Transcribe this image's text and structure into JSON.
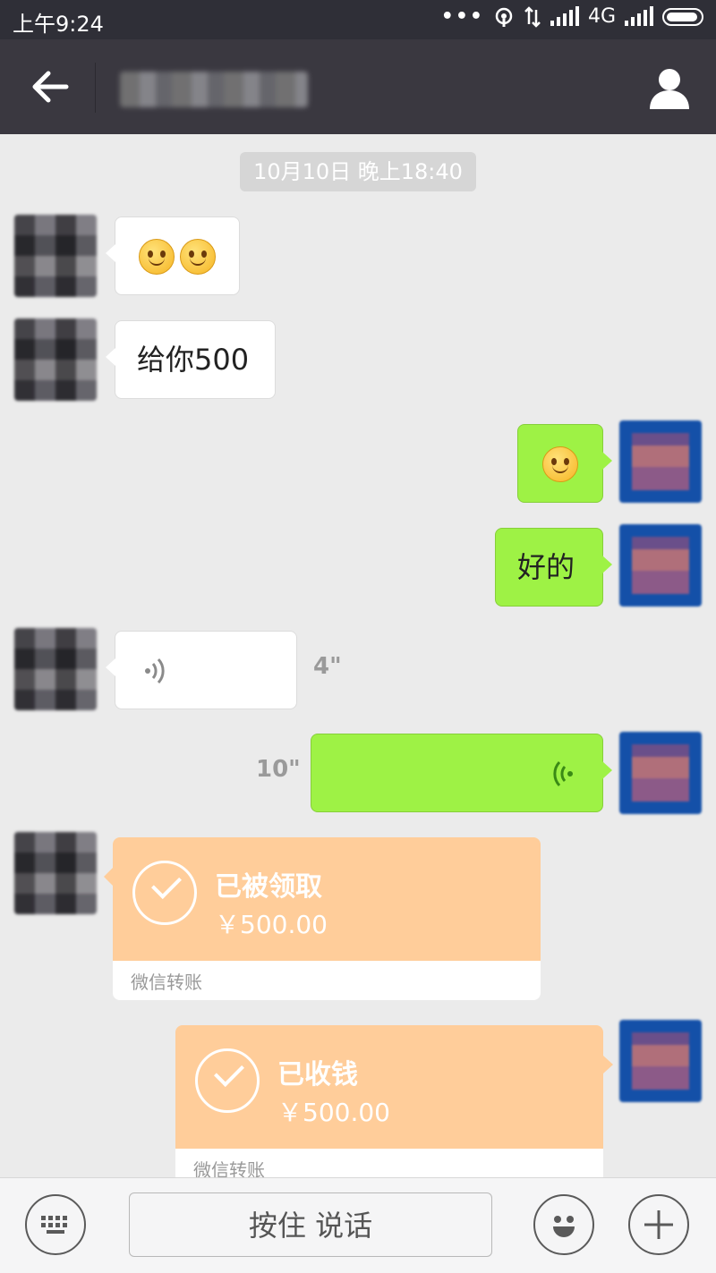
{
  "status_bar": {
    "time": "上午9:24",
    "network": "4G"
  },
  "header": {
    "title": "",
    "back_icon": "back-arrow-icon",
    "profile_icon": "person-icon"
  },
  "timestamp": "10月10日 晚上18:40",
  "messages": [
    {
      "side": "in",
      "type": "emoji",
      "text": ""
    },
    {
      "side": "in",
      "type": "text",
      "text": "给你500"
    },
    {
      "side": "out",
      "type": "emoji",
      "text": ""
    },
    {
      "side": "out",
      "type": "text",
      "text": "好的"
    },
    {
      "side": "in",
      "type": "voice",
      "duration": "4\""
    },
    {
      "side": "out",
      "type": "voice",
      "duration": "10\""
    },
    {
      "side": "in",
      "type": "transfer",
      "status": "已被领取",
      "amount": "￥500.00",
      "source": "微信转账"
    },
    {
      "side": "out",
      "type": "transfer",
      "status": "已收钱",
      "amount": "￥500.00",
      "source": "微信转账"
    }
  ],
  "input_bar": {
    "hold_to_talk": "按住 说话"
  },
  "colors": {
    "outgoing_bubble": "#9ef245",
    "transfer_card": "#ffcd9a",
    "nav_bg": "#3a3840",
    "status_bg": "#2f2f37"
  }
}
